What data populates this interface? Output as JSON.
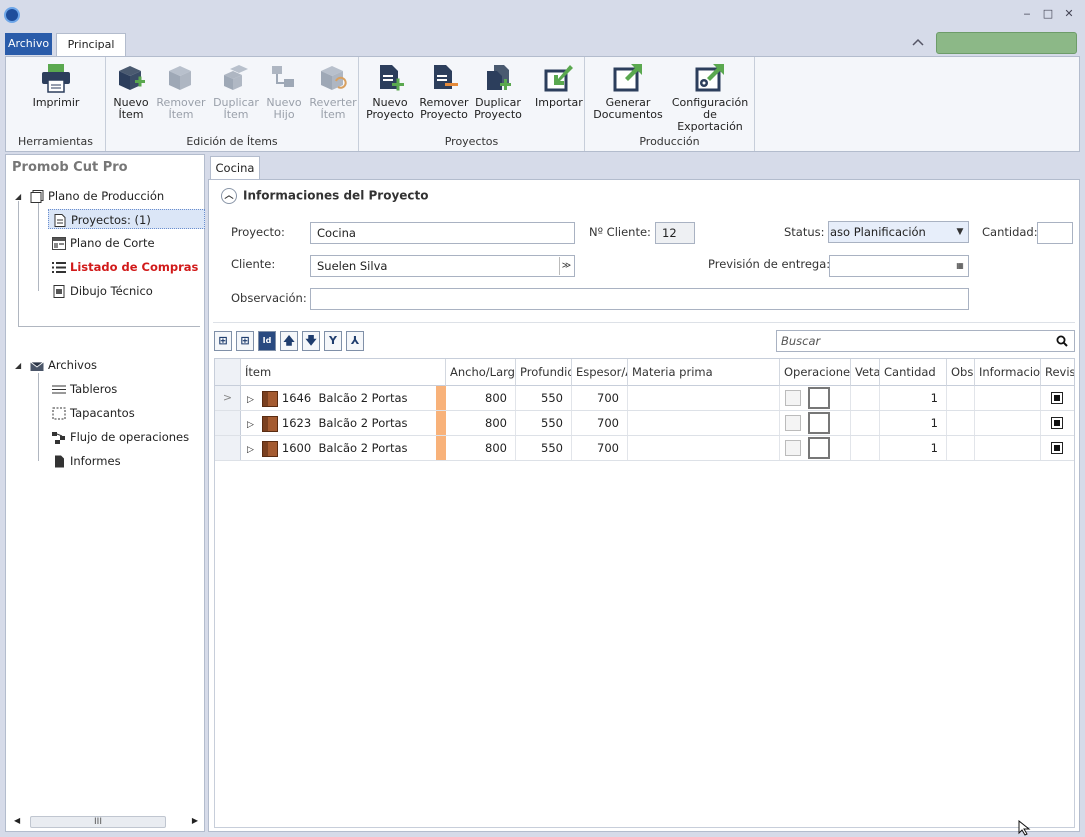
{
  "window": {
    "minimize_glyph": "‒",
    "maximize_glyph": "□",
    "close_glyph": "✕"
  },
  "ribbon_tabs": {
    "archivo": "Archivo",
    "principal": "Principal"
  },
  "ribbon": {
    "groups": {
      "herramientas": "Herramientas",
      "edicion": "Edición de Ítems",
      "proyectos": "Proyectos",
      "produccion": "Producción"
    },
    "buttons": {
      "imprimir": "Imprimir",
      "nuevo_item_1": "Nuevo",
      "nuevo_item_2": "Ítem",
      "remover_item_1": "Remover",
      "remover_item_2": "Ítem",
      "duplicar_item_1": "Duplicar",
      "duplicar_item_2": "Ítem",
      "nuevo_hijo_1": "Nuevo",
      "nuevo_hijo_2": "Hijo",
      "revertir_item_1": "Reverter",
      "revertir_item_2": "Ítem",
      "nuevo_proyecto_1": "Nuevo",
      "nuevo_proyecto_2": "Proyecto",
      "remover_proyecto_1": "Remover",
      "remover_proyecto_2": "Proyecto",
      "duplicar_proyecto_1": "Duplicar",
      "duplicar_proyecto_2": "Proyecto",
      "importar": "Importar",
      "generar_1": "Generar",
      "generar_2": "Documentos",
      "config_1": "Configuración",
      "config_2": "de Exportación"
    }
  },
  "left_panel": {
    "title": "Promob Cut Pro",
    "tree": {
      "plano_produccion": "Plano de Producción",
      "proyectos": "Proyectos: (1)",
      "plano_corte": "Plano de Corte",
      "listado_compras": "Listado de Compras",
      "dibujo_tecnico": "Dibujo Técnico",
      "archivos": "Archivos",
      "tableros": "Tableros",
      "tapacantos": "Tapacantos",
      "flujo": "Flujo de operaciones",
      "informes": "Informes"
    },
    "scroll_grip": "III"
  },
  "document_tab": "Cocina",
  "project_info": {
    "title": "Informaciones del Proyecto",
    "labels": {
      "proyecto": "Proyecto:",
      "cliente_num": "Nº Cliente:",
      "status": "Status:",
      "cantidad": "Cantidad:",
      "cliente": "Cliente:",
      "prevision": "Previsión de entrega:",
      "observacion": "Observación:"
    },
    "values": {
      "proyecto": "Cocina",
      "cliente_num": "12",
      "status": "aso Planificación",
      "cantidad": "",
      "cliente": "Suelen Silva",
      "prevision": "",
      "observacion": ""
    }
  },
  "search": {
    "placeholder": "Buscar"
  },
  "grid": {
    "columns": {
      "item": "Ítem",
      "ancho": "Ancho/Largo",
      "profundidad": "Profundidad",
      "espesor": "Espesor/Altura",
      "materia": "Materia prima",
      "operaciones": "Operaciones",
      "veta": "Veta",
      "cantidad": "Cantidad",
      "obs": "Obs",
      "informacion": "Informaciones",
      "revision": "Revisión"
    },
    "rows": [
      {
        "code": "1646",
        "name": "Balcão 2 Portas",
        "ancho": "800",
        "prof": "550",
        "esp": "700",
        "cantidad": "1"
      },
      {
        "code": "1623",
        "name": "Balcão 2 Portas",
        "ancho": "800",
        "prof": "550",
        "esp": "700",
        "cantidad": "1"
      },
      {
        "code": "1600",
        "name": "Balcão 2 Portas",
        "ancho": "800",
        "prof": "550",
        "esp": "700",
        "cantidad": "1"
      }
    ]
  },
  "colors": {
    "accent": "#2a5caa",
    "alert": "#d11a1a",
    "status_green": "#8cb887",
    "item_color_tag": "#f8b27a"
  }
}
